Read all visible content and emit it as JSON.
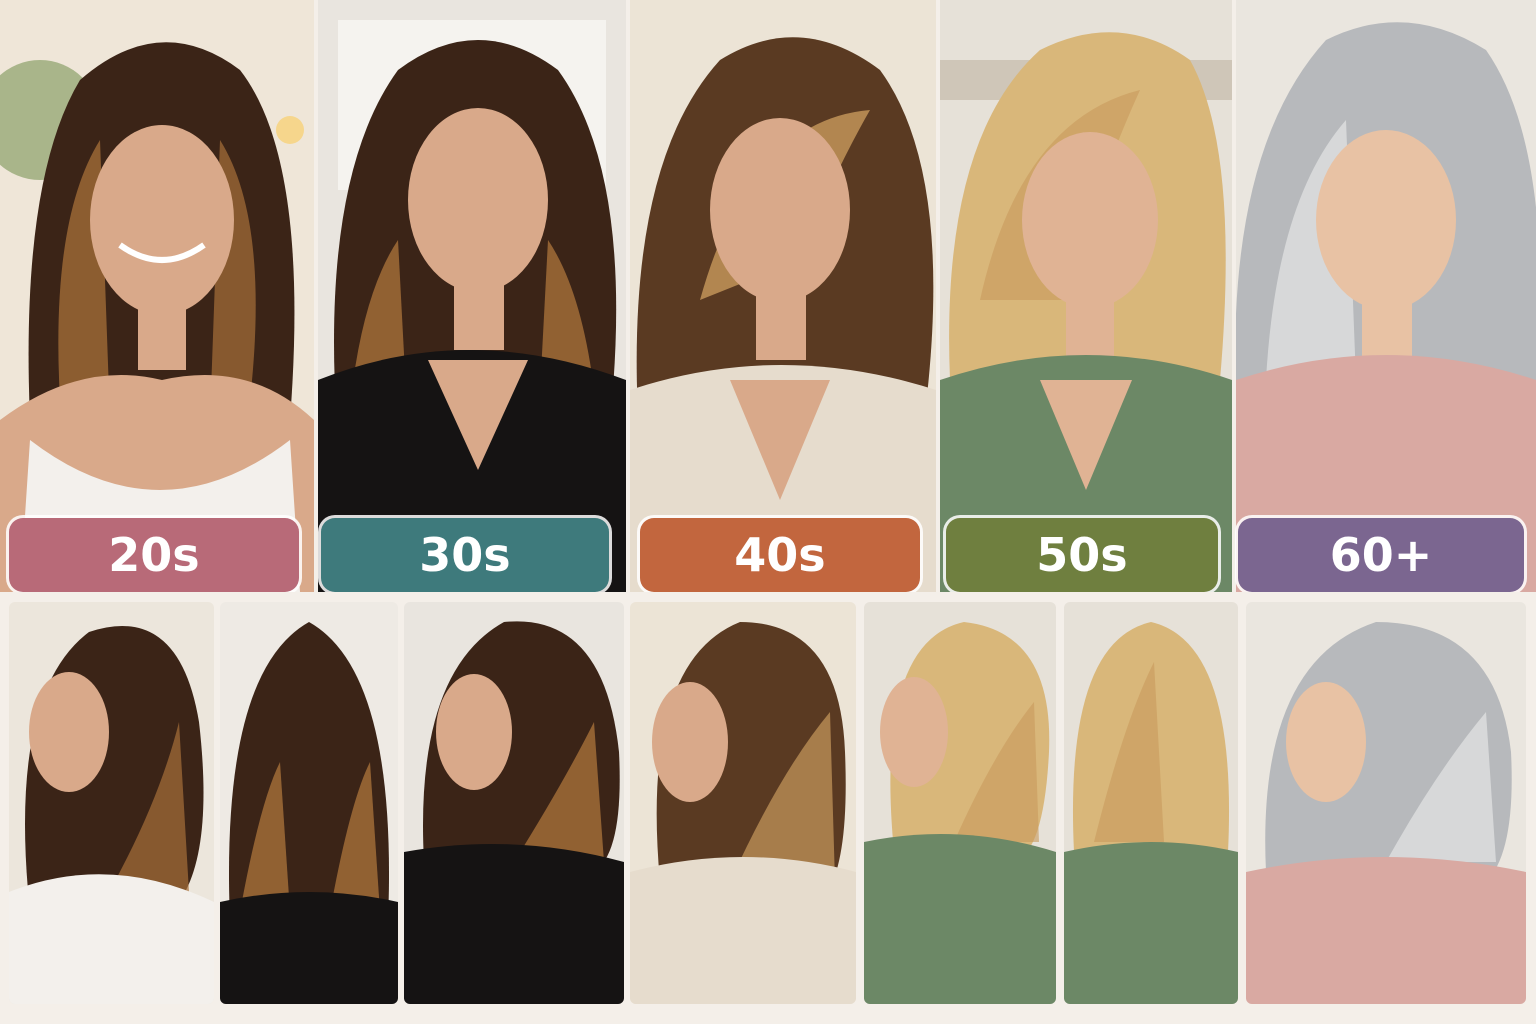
{
  "age_groups": [
    {
      "label": "20s",
      "color": "#b86a78"
    },
    {
      "label": "30s",
      "color": "#3e7a7c"
    },
    {
      "label": "40s",
      "color": "#c2663e"
    },
    {
      "label": "50s",
      "color": "#6f7f3f"
    },
    {
      "label": "60+",
      "color": "#7b6690"
    }
  ],
  "palette": {
    "hair_dark": "#3b2417",
    "hair_caramel": "#a8703a",
    "hair_honey": "#c89a5c",
    "hair_blonde": "#d9b77a",
    "hair_silver": "#b7b9bc",
    "skin": "#d9a98a",
    "skin_light": "#e8c2a4",
    "top_white": "#f3f0ec",
    "top_black": "#151313",
    "top_cream": "#e6dccd",
    "top_green": "#6c8866",
    "top_pink": "#d9a9a2"
  }
}
